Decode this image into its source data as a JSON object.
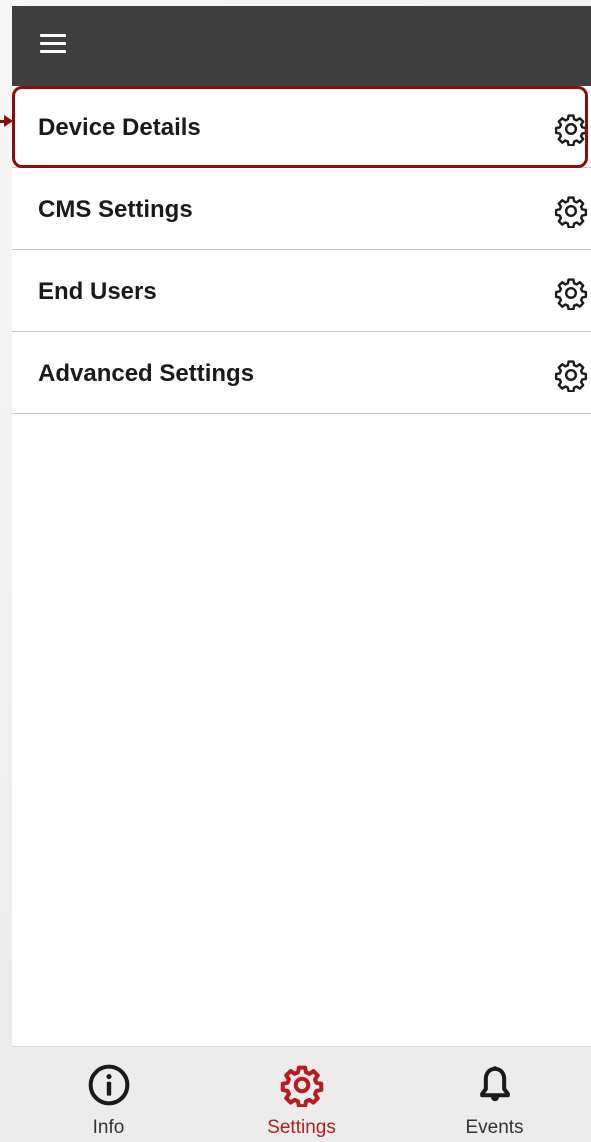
{
  "colors": {
    "appbar": "#3e3e3e",
    "accent": "#b51d1d",
    "highlight_border": "#8b0d0d",
    "tabbar_bg": "#ececec"
  },
  "appbar": {
    "menu_icon": "hamburger-menu-icon"
  },
  "settings_list": {
    "items": [
      {
        "label": "Device Details",
        "icon": "gear-icon",
        "highlighted": true
      },
      {
        "label": "CMS Settings",
        "icon": "gear-icon",
        "highlighted": false
      },
      {
        "label": "End Users",
        "icon": "gear-icon",
        "highlighted": false
      },
      {
        "label": "Advanced Settings",
        "icon": "gear-icon",
        "highlighted": false
      }
    ]
  },
  "tabbar": {
    "tabs": [
      {
        "label": "Info",
        "icon": "info-icon",
        "active": false
      },
      {
        "label": "Settings",
        "icon": "gear-icon",
        "active": true
      },
      {
        "label": "Events",
        "icon": "bell-icon",
        "active": false
      }
    ]
  }
}
